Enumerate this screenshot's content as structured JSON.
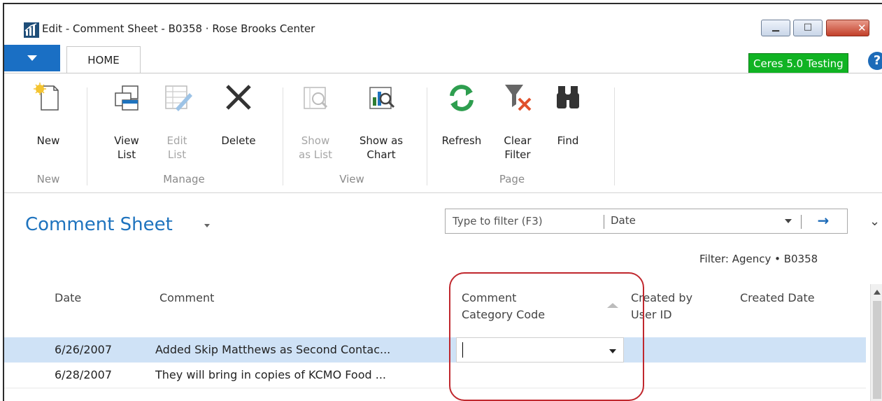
{
  "window": {
    "title": "Edit - Comment Sheet - B0358 · Rose Brooks Center",
    "minimize_glyph": "▁",
    "maximize_glyph": "□",
    "close_glyph": "✕"
  },
  "ribbon": {
    "tab": "HOME",
    "environment_badge": "Ceres 5.0 Testing",
    "help_glyph": "?",
    "buttons": {
      "new": "New",
      "view_list_1": "View",
      "view_list_2": "List",
      "edit_list_1": "Edit",
      "edit_list_2": "List",
      "delete": "Delete",
      "show_as_list_1": "Show",
      "show_as_list_2": "as List",
      "show_as_chart_1": "Show as",
      "show_as_chart_2": "Chart",
      "refresh": "Refresh",
      "clear_filter_1": "Clear",
      "clear_filter_2": "Filter",
      "find": "Find"
    },
    "groups": {
      "new": "New",
      "manage": "Manage",
      "view": "View",
      "page": "Page"
    }
  },
  "page": {
    "title": "Comment Sheet",
    "filter_placeholder": "Type to filter (F3)",
    "filter_field": "Date",
    "go_glyph": "→",
    "collapse_glyph": "⌄",
    "filter_label": "Filter: Agency • B0358"
  },
  "grid": {
    "columns": {
      "date": "Date",
      "comment": "Comment",
      "category_1": "Comment",
      "category_2": "Category Code",
      "created_by_1": "Created by",
      "created_by_2": "User ID",
      "created_date": "Created Date"
    },
    "rows": [
      {
        "date": "6/26/2007",
        "comment": "Added Skip Matthews as Second Contac...",
        "category": "",
        "created_by": "",
        "created_date": ""
      },
      {
        "date": "6/28/2007",
        "comment": "They will bring in copies of KCMO Food ...",
        "category": "",
        "created_by": "",
        "created_date": ""
      }
    ]
  },
  "colors": {
    "accent": "#1e73be",
    "badge": "#10b323",
    "selected_row": "#cfe2f6",
    "annotation": "#c0272d"
  }
}
